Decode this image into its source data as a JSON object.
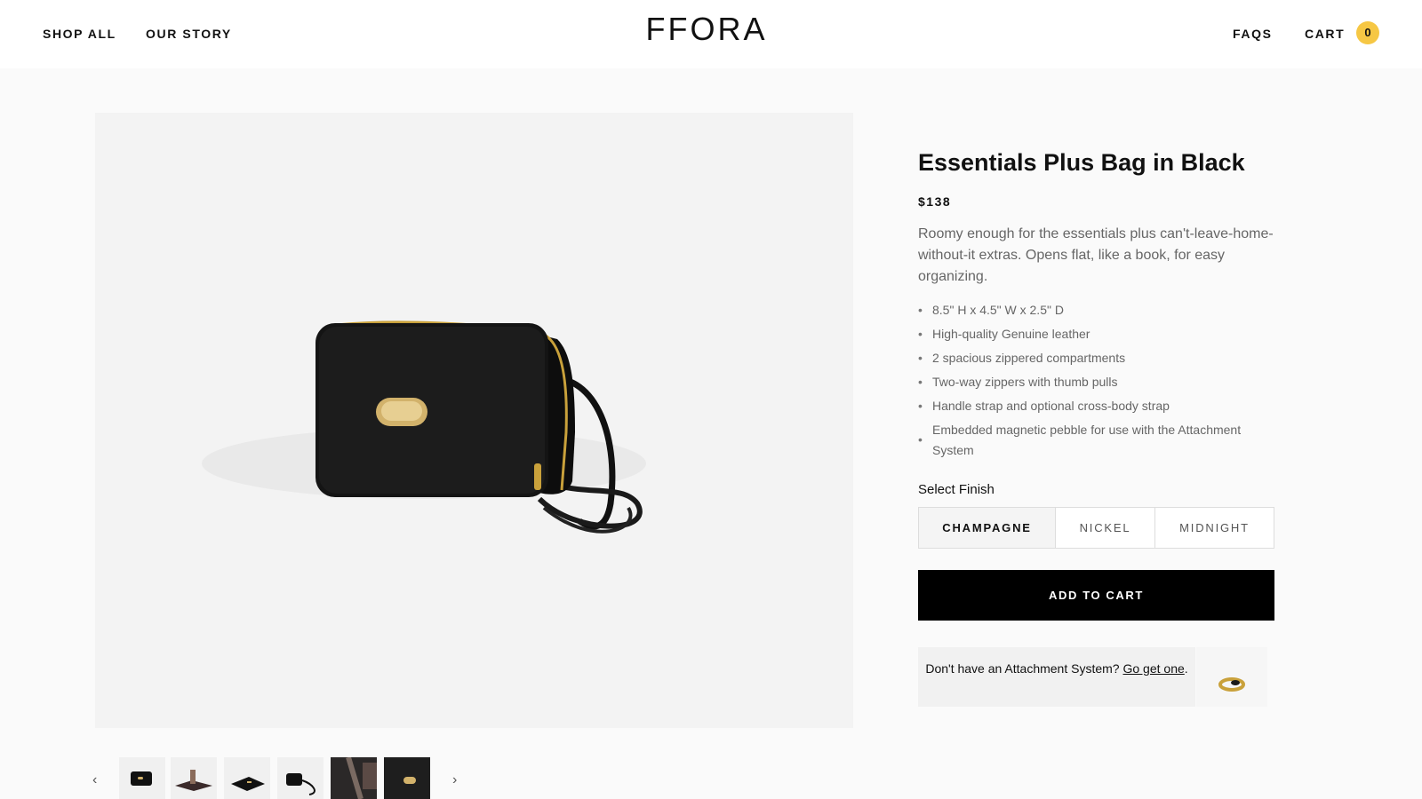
{
  "header": {
    "nav_left": [
      "SHOP ALL",
      "OUR STORY"
    ],
    "logo": "FFORA",
    "faqs": "FAQS",
    "cart_label": "CART",
    "cart_count": "0",
    "cart_badge_color": "#f6c744"
  },
  "gallery": {
    "main_image_icon": "black-leather-bag-image",
    "prev_icon": "‹",
    "next_icon": "›",
    "thumbnail_icons": [
      "bag-front-thumb",
      "bag-open-thumb",
      "bag-side-thumb",
      "bag-strap-thumb",
      "bag-worn-thumb",
      "bag-closeup-thumb"
    ]
  },
  "product": {
    "title": "Essentials Plus Bag in Black",
    "price": "$138",
    "description": "Roomy enough for the essentials plus can't-leave-home-without-it extras. Opens flat, like a book, for easy organizing.",
    "features": [
      "8.5\" H x 4.5\" W x 2.5\" D",
      "High-quality Genuine leather",
      "2 spacious zippered compartments",
      "Two-way zippers with thumb pulls",
      "Handle strap and optional cross-body strap",
      "Embedded magnetic pebble for use with the Attachment System"
    ],
    "bullet": "•",
    "finish_label": "Select Finish",
    "finish_options": [
      "CHAMPAGNE",
      "NICKEL",
      "MIDNIGHT"
    ],
    "finish_selected": "CHAMPAGNE",
    "add_to_cart": "ADD TO CART"
  },
  "promo": {
    "text": "Don't have an Attachment System?",
    "link": "Go get one",
    "suffix": ".",
    "image_icon": "gold-ring-image"
  }
}
